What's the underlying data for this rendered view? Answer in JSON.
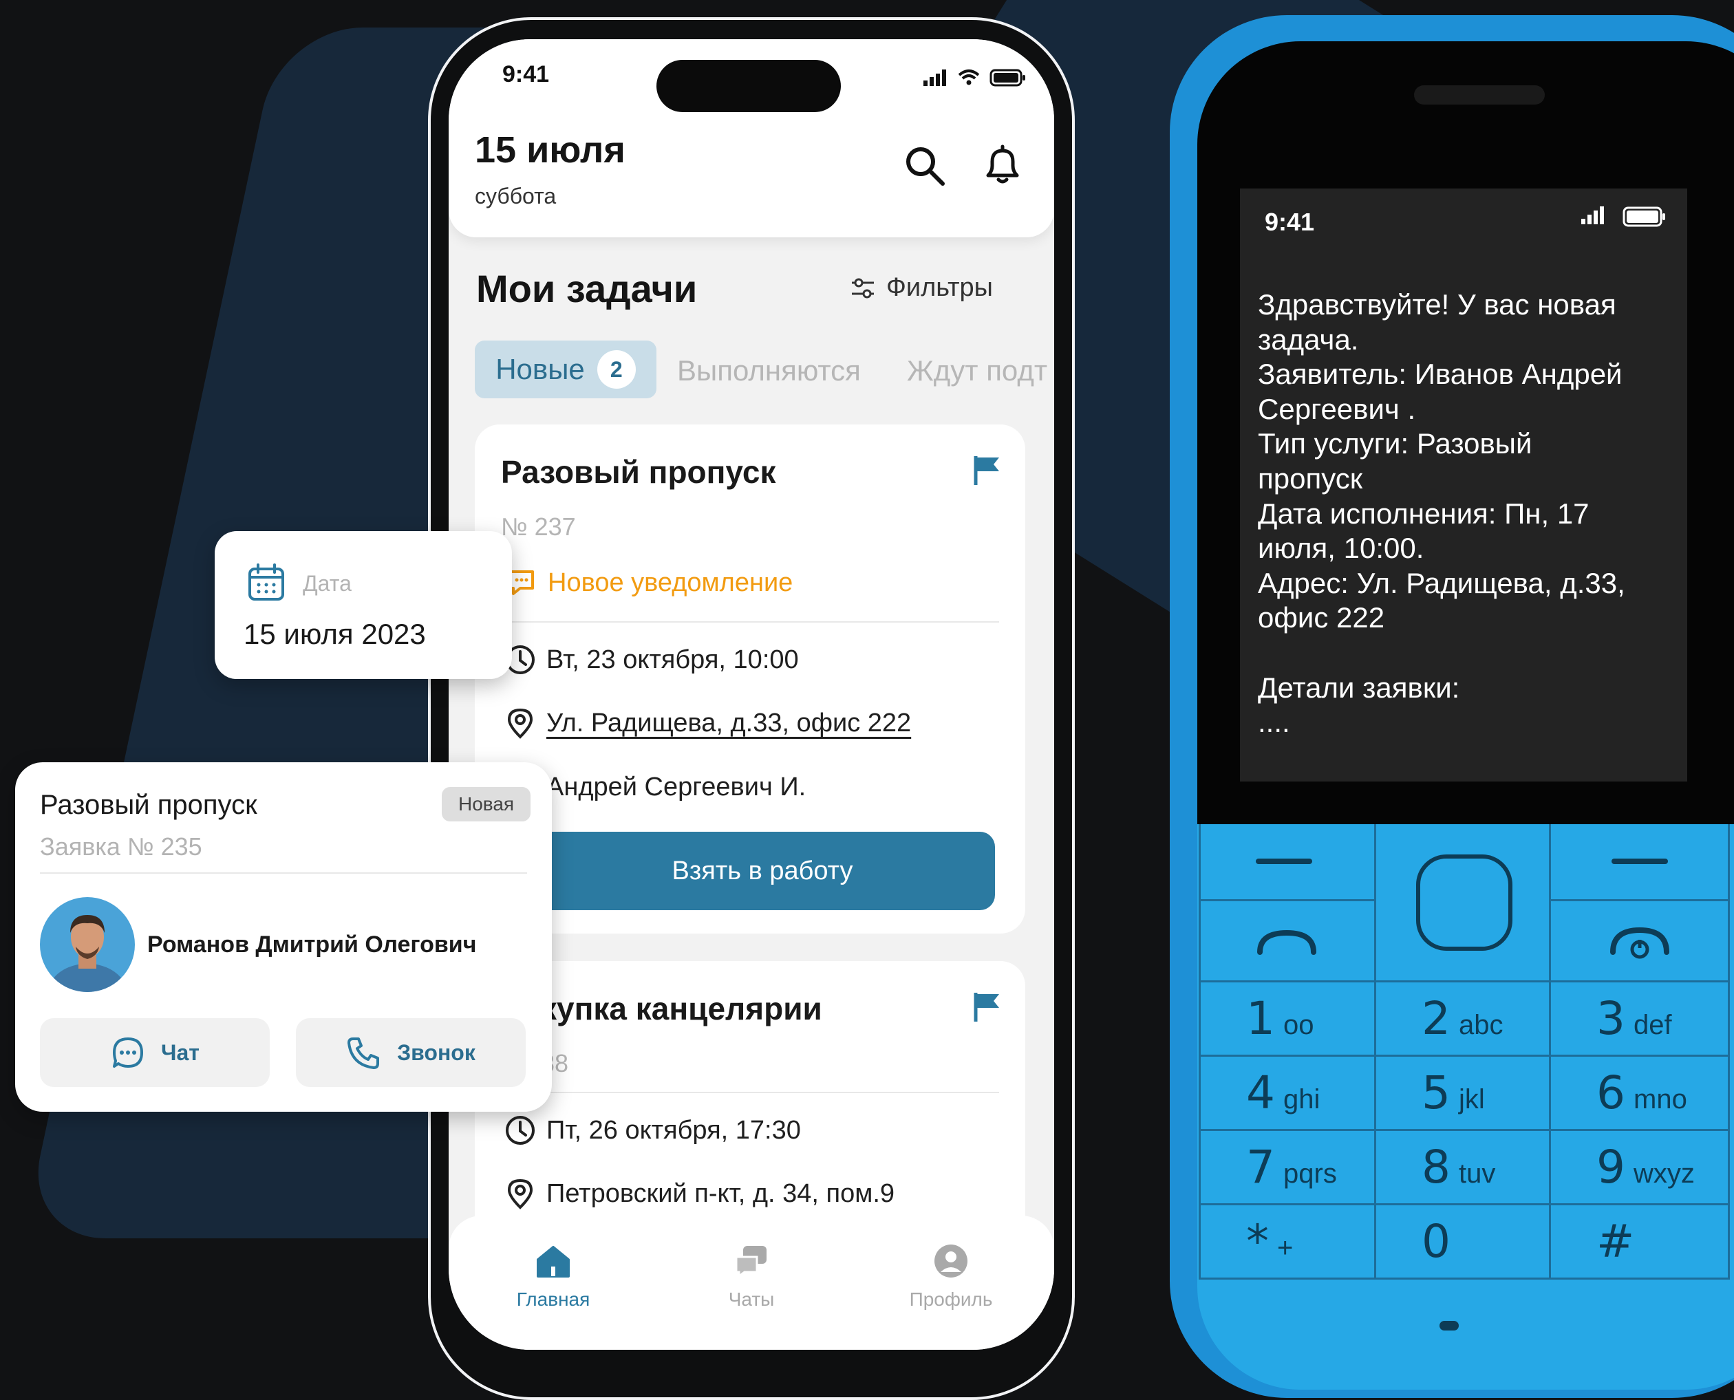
{
  "phone": {
    "status": {
      "time": "9:41"
    },
    "header": {
      "date": "15 июля",
      "weekday": "суббота"
    },
    "section": {
      "title": "Мои задачи",
      "filters_label": "Фильтры"
    },
    "tabs": [
      {
        "label": "Новые",
        "badge": "2"
      },
      {
        "label": "Выполняются"
      },
      {
        "label": "Ждут подт"
      }
    ],
    "cards": [
      {
        "title": "Разовый пропуск",
        "number": "№ 237",
        "notification": "Новое уведомление",
        "datetime": "Вт, 23 октября, 10:00",
        "address": "Ул. Радищева, д.33, офис 222",
        "person": "Андрей Сергеевич И.",
        "action": "Взять в работу"
      },
      {
        "title": "купка канцелярии",
        "number": "38",
        "datetime": "Пт, 26 октября, 17:30",
        "address": "Петровский п-кт, д. 34, пом.9"
      }
    ],
    "nav": [
      {
        "label": "Главная",
        "icon": "home-icon",
        "active": true
      },
      {
        "label": "Чаты",
        "icon": "chats-icon"
      },
      {
        "label": "Профиль",
        "icon": "profile-icon"
      }
    ]
  },
  "date_card": {
    "label": "Дата",
    "value": "15 июля 2023"
  },
  "person_card": {
    "title": "Разовый пропуск",
    "status": "Новая",
    "request": "Заявка № 235",
    "name": "Романов Дмитрий Олегович",
    "chat_label": "Чат",
    "call_label": "Звонок"
  },
  "feature_phone": {
    "time": "9:41",
    "message": "Здравствуйте! У вас новая\nзадача.\nЗаявитель: Иванов Андрей\nСергеевич .\nТип услуги: Разовый\nпропуск\nДата исполнения: Пн, 17\nиюля, 10:00.\nАдрес: Ул. Радищева, д.33,\nофис 222\n\nДетали заявки:\n....",
    "keys": [
      {
        "num": "1",
        "letters": "oo"
      },
      {
        "num": "2",
        "letters": "abc"
      },
      {
        "num": "3",
        "letters": "def"
      },
      {
        "num": "4",
        "letters": "ghi"
      },
      {
        "num": "5",
        "letters": "jkl"
      },
      {
        "num": "6",
        "letters": "mno"
      },
      {
        "num": "7",
        "letters": "pqrs"
      },
      {
        "num": "8",
        "letters": "tuv"
      },
      {
        "num": "9",
        "letters": "wxyz"
      },
      {
        "num": "*",
        "letters": "+"
      },
      {
        "num": "0",
        "letters": ""
      },
      {
        "num": "#",
        "letters": ""
      }
    ]
  },
  "colors": {
    "accent": "#2b7aa1",
    "tab_bg": "#c9dde8",
    "notification": "#f29b11",
    "feature_phone": "#26a8e6"
  }
}
